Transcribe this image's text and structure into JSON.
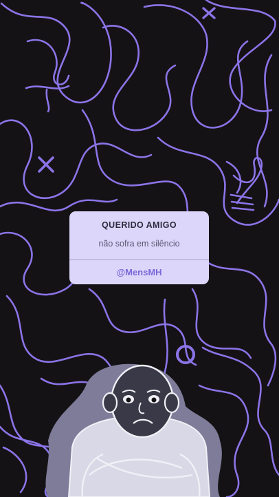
{
  "card": {
    "title": "QUERIDO AMIGO",
    "subtitle": "não sofra em silêncio",
    "handle": "@MensMH"
  },
  "colors": {
    "background": "#141214",
    "scribble": "#8b74e8",
    "card_background": "#ddd6fb",
    "handle": "#7b68d8",
    "figure_shadow": "#7e7c99"
  },
  "icons": [
    "x-mark-icon",
    "circle-icon",
    "sad-person-illustration"
  ]
}
